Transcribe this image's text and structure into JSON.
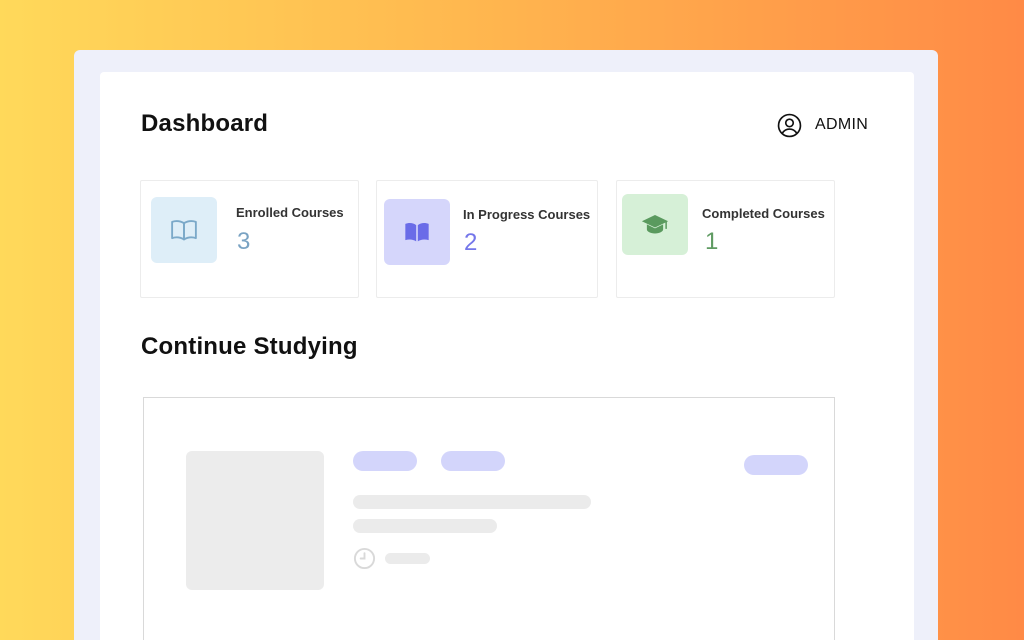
{
  "header": {
    "title": "Dashboard",
    "user_label": "ADMIN"
  },
  "stats": [
    {
      "label": "Enrolled Courses",
      "value": "3",
      "icon": "open-book-outline-icon",
      "icon_bg": "#deeef8",
      "icon_color": "#7ba9c9",
      "value_color": "#7aa3c3"
    },
    {
      "label": "In Progress Courses",
      "value": "2",
      "icon": "open-book-filled-icon",
      "icon_bg": "#d5d6fb",
      "icon_color": "#6a6ce8",
      "value_color": "#7476ea"
    },
    {
      "label": "Completed Courses",
      "value": "1",
      "icon": "graduation-cap-icon",
      "icon_bg": "#d6f0d7",
      "icon_color": "#5a9a5e",
      "value_color": "#5f9b62"
    }
  ],
  "section": {
    "title": "Continue Studying"
  },
  "colors": {
    "skeleton_tag": "#d3d5fb",
    "skeleton_line": "#ebebeb",
    "background_gradient_start": "#ffd95a",
    "background_gradient_end": "#ff8a46"
  }
}
